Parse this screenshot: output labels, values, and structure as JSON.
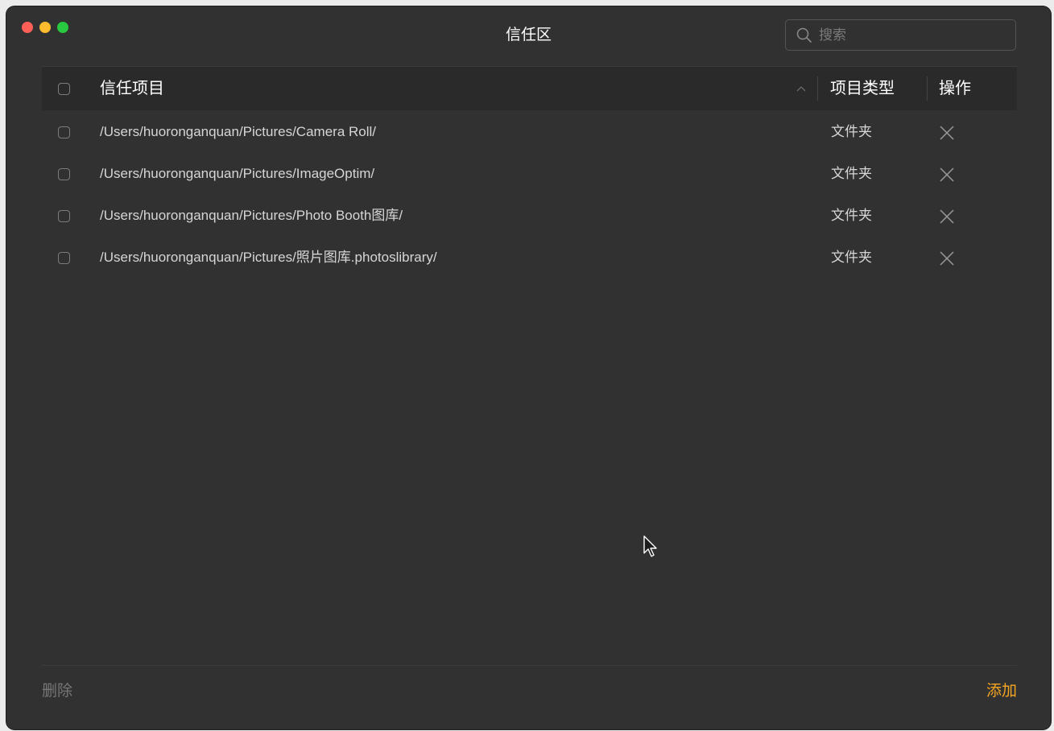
{
  "window": {
    "title": "信任区",
    "traffic_lights": {
      "close": "#fe5f57",
      "minimize": "#febc2e",
      "zoom": "#28c840"
    }
  },
  "search": {
    "placeholder": "搜索",
    "value": "",
    "icon": "search-icon"
  },
  "table": {
    "columns": {
      "item": "信任项目",
      "type": "项目类型",
      "action": "操作"
    },
    "sort_indicator": "^",
    "rows": [
      {
        "path": "/Users/huoronganquan/Pictures/Camera Roll/",
        "type": "文件夹",
        "checked": false,
        "action_icon": "close-icon"
      },
      {
        "path": "/Users/huoronganquan/Pictures/ImageOptim/",
        "type": "文件夹",
        "checked": false,
        "action_icon": "close-icon"
      },
      {
        "path": "/Users/huoronganquan/Pictures/Photo Booth图库/",
        "type": "文件夹",
        "checked": false,
        "action_icon": "close-icon"
      },
      {
        "path": "/Users/huoronganquan/Pictures/照片图库.photoslibrary/",
        "type": "文件夹",
        "checked": false,
        "action_icon": "close-icon"
      }
    ]
  },
  "footer": {
    "delete_label": "删除",
    "add_label": "添加",
    "add_color": "#f5a623"
  }
}
